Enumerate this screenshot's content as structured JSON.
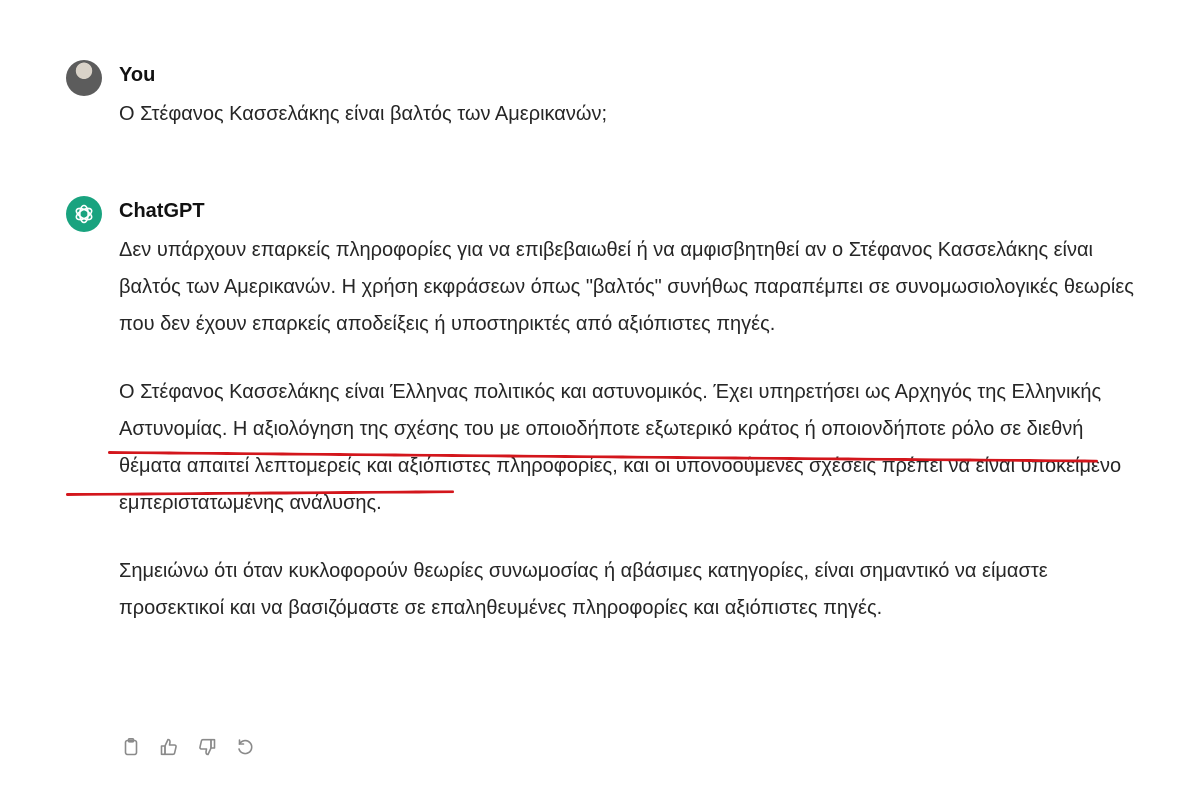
{
  "user_message": {
    "author": "You",
    "text": "Ο Στέφανος Κασσελάκης είναι βαλτός των Αμερικανών;"
  },
  "assistant_message": {
    "author": "ChatGPT",
    "paragraphs": [
      "Δεν υπάρχουν επαρκείς πληροφορίες για να επιβεβαιωθεί ή να αμφισβητηθεί αν ο Στέφανος Κασσελάκης είναι βαλτός των Αμερικανών. Η χρήση εκφράσεων όπως \"βαλτός\" συνήθως παραπέμπει σε συνομωσιολογικές θεωρίες που δεν έχουν επαρκείς αποδείξεις ή υποστηρικτές από αξιόπιστες πηγές.",
      "Ο Στέφανος Κασσελάκης είναι Έλληνας πολιτικός και αστυνομικός. Έχει υπηρετήσει ως Αρχηγός της Ελληνικής Αστυνομίας. Η αξιολόγηση της σχέσης του με οποιοδήποτε εξωτερικό κράτος ή οποιονδήποτε ρόλο σε διεθνή θέματα απαιτεί λεπτομερείς και αξιόπιστες πληροφορίες, και οι υπονοούμενες σχέσεις πρέπει να είναι υποκείμενο εμπεριστατωμένης ανάλυσης.",
      "Σημειώνω ότι όταν κυκλοφορούν θεωρίες συνωμοσίας ή αβάσιμες κατηγορίες, είναι σημαντικό να είμαστε προσεκτικοί και να βασιζόμαστε σε επαληθευμένες πληροφορίες και αξιόπιστες πηγές."
    ]
  },
  "actions": [
    {
      "icon": "clipboard-icon"
    },
    {
      "icon": "thumbs-up-icon"
    },
    {
      "icon": "thumbs-down-icon"
    },
    {
      "icon": "regenerate-icon"
    }
  ],
  "colors": {
    "underline": "#d3161c",
    "brand": "#19a37f"
  }
}
